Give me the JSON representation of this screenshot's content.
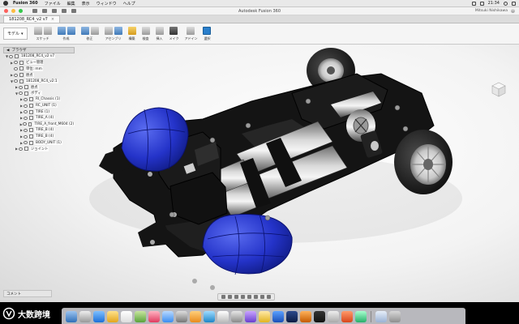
{
  "menubar": {
    "app_name": "Fusion 360",
    "items": [
      "ファイル",
      "編集",
      "表示",
      "ウィンドウ",
      "ヘルプ"
    ],
    "clock": "21:34"
  },
  "titlebar": {
    "title": "Autodesk Fusion 360",
    "user": "Mitsuki Nishikawa"
  },
  "document_tab": {
    "label": "181208_RC4_v2 v7"
  },
  "toolbar": {
    "workspace": "モデル",
    "groups": [
      {
        "label": "スケッチ",
        "icons": [
          "sketch-icon",
          "finish-sketch-icon"
        ],
        "colors": [
          "grey",
          "grey"
        ]
      },
      {
        "label": "作成",
        "icons": [
          "box-icon",
          "cylinder-icon"
        ],
        "colors": [
          "blue",
          "blue"
        ]
      },
      {
        "label": "修正",
        "icons": [
          "press-pull-icon",
          "fillet-icon"
        ],
        "colors": [
          "blue",
          "grey"
        ]
      },
      {
        "label": "アセンブリ",
        "icons": [
          "joint-icon",
          "as-built-icon"
        ],
        "colors": [
          "grey",
          "blue"
        ]
      },
      {
        "label": "構築",
        "icons": [
          "plane-icon"
        ],
        "colors": [
          "yellow"
        ]
      },
      {
        "label": "検査",
        "icons": [
          "measure-icon"
        ],
        "colors": [
          "grey"
        ]
      },
      {
        "label": "挿入",
        "icons": [
          "insert-image-icon"
        ],
        "colors": [
          "grey"
        ]
      },
      {
        "label": "メイク",
        "icons": [
          "3d-print-icon"
        ],
        "colors": [
          "dark"
        ]
      },
      {
        "label": "アドイン",
        "icons": [
          "scripts-icon"
        ],
        "colors": [
          "grey"
        ]
      },
      {
        "label": "選択",
        "icons": [
          "select-icon"
        ],
        "colors": [
          "sel"
        ]
      }
    ]
  },
  "browser": {
    "title": "ブラウザ",
    "rows": [
      {
        "label": "181208_RC4_v2 v7",
        "depth": 0,
        "arrow": "▼",
        "kind": "root"
      },
      {
        "label": "ビュー管理",
        "depth": 1,
        "arrow": "▶",
        "kind": "folder"
      },
      {
        "label": "単位: mm",
        "depth": 1,
        "arrow": "",
        "kind": "doc"
      },
      {
        "label": "原点",
        "depth": 1,
        "arrow": "▶",
        "kind": "folder"
      },
      {
        "label": "181208_RC4_v2:1",
        "depth": 1,
        "arrow": "▼",
        "kind": "comp"
      },
      {
        "label": "原点",
        "depth": 2,
        "arrow": "▶",
        "kind": "folder"
      },
      {
        "label": "ボディ",
        "depth": 2,
        "arrow": "▼",
        "kind": "folder"
      },
      {
        "label": "RI_Chassis (1)",
        "depth": 3,
        "arrow": "▶",
        "kind": "comp"
      },
      {
        "label": "RC_UNIT (1)",
        "depth": 3,
        "arrow": "▶",
        "kind": "comp"
      },
      {
        "label": "TIRE (1)",
        "depth": 3,
        "arrow": "▶",
        "kind": "comp"
      },
      {
        "label": "TIRE_A (4)",
        "depth": 3,
        "arrow": "▶",
        "kind": "comp"
      },
      {
        "label": "TIRE_A_front_M604 (2)",
        "depth": 3,
        "arrow": "▶",
        "kind": "comp"
      },
      {
        "label": "TIRE_B (4)",
        "depth": 3,
        "arrow": "▶",
        "kind": "comp"
      },
      {
        "label": "TIRE_B (4)",
        "depth": 3,
        "arrow": "▶",
        "kind": "comp"
      },
      {
        "label": "BODY_UNIT (1)",
        "depth": 3,
        "arrow": "▶",
        "kind": "comp"
      },
      {
        "label": "ジョイント",
        "depth": 2,
        "arrow": "▶",
        "kind": "folder"
      }
    ]
  },
  "comments_label": "コメント",
  "watermark_text": "大数跨境",
  "colors": {
    "accent": "#2a7fcb",
    "bumper_blue": "#2433c9",
    "chassis_black": "#141414",
    "viewport_bg": "#f3f3f3"
  }
}
